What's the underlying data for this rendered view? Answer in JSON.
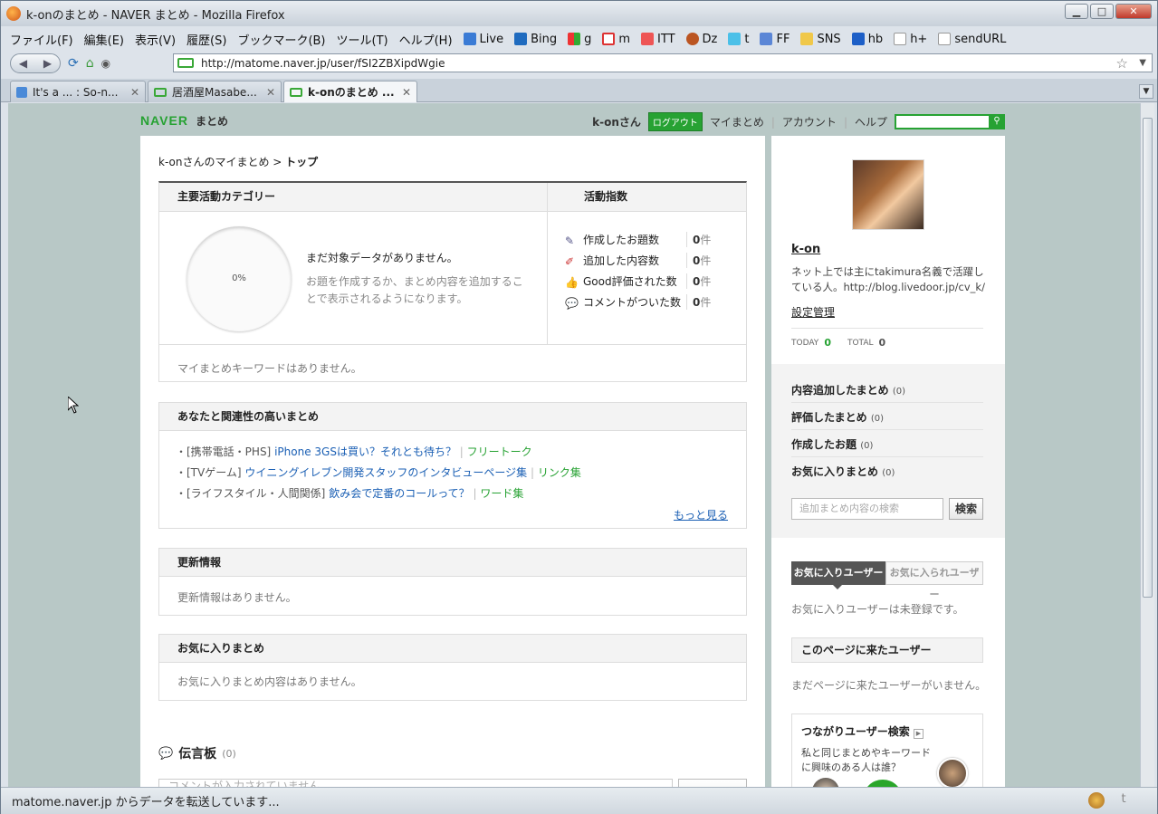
{
  "window": {
    "title": "k-onのまとめ - NAVER まとめ - Mozilla Firefox"
  },
  "menu": {
    "items": [
      "ファイル(F)",
      "編集(E)",
      "表示(V)",
      "履歴(S)",
      "ブックマーク(B)",
      "ツール(T)",
      "ヘルプ(H)"
    ],
    "bookmarks": [
      "Live",
      "Bing",
      "g",
      "m",
      "ITT",
      "Dz",
      "t",
      "FF",
      "SNS",
      "hb",
      "h+",
      "sendURL"
    ]
  },
  "url": "http://matome.naver.jp/user/fSI2ZBXipdWgie",
  "tabs": [
    {
      "label": "It's a ... : So-n..."
    },
    {
      "label": "居酒屋Masabe..."
    },
    {
      "label": "k-onのまとめ ..."
    }
  ],
  "status": "matome.naver.jp からデータを転送しています...",
  "site": {
    "logo": "NAVER",
    "logo_sub": "まとめ",
    "user": "k-onさん",
    "logout": "ログアウト",
    "links": [
      "マイまとめ",
      "アカウント",
      "ヘルプ"
    ]
  },
  "main": {
    "breadcrumb_user": "k-onさんのマイまとめ",
    "breadcrumb_sep": " > ",
    "breadcrumb_current": "トップ",
    "category_head": "主要活動カテゴリー",
    "activity_head": "活動指数",
    "pie_label": "0%",
    "nodata": "まだ対象データがありません。",
    "nodata_desc": "お題を作成するか、まとめ内容を追加することで表示されるようになります。",
    "stats": [
      {
        "label": "作成したお題数",
        "value": "0",
        "unit": "件"
      },
      {
        "label": "追加した内容数",
        "value": "0",
        "unit": "件"
      },
      {
        "label": "Good評価された数",
        "value": "0",
        "unit": "件"
      },
      {
        "label": "コメントがついた数",
        "value": "0",
        "unit": "件"
      }
    ],
    "keywords_empty": "マイまとめキーワードはありません。",
    "related_head": "あなたと関連性の高いまとめ",
    "related": [
      {
        "cat": "・[携帯電話・PHS]",
        "title": "iPhone 3GSは買い？それとも待ち？",
        "tag": "フリートーク"
      },
      {
        "cat": "・[TVゲーム]",
        "title": "ウイニングイレブン開発スタッフのインタビューページ集",
        "tag": "リンク集"
      },
      {
        "cat": "・[ライフスタイル・人間関係]",
        "title": "飲み会で定番のコールって？",
        "tag": "ワード集"
      }
    ],
    "more": "もっと見る",
    "updates_head": "更新情報",
    "updates_empty": "更新情報はありません。",
    "fav_head": "お気に入りまとめ",
    "fav_empty": "お気に入りまとめ内容はありません。",
    "board_title": "伝言板",
    "board_count": "(0)",
    "comment_placeholder": "コメントが入力されていません"
  },
  "side": {
    "name": "k-on",
    "desc": "ネット上では主にtakimura名義で活躍している人。http://blog.livedoor.jp/cv_k/",
    "settings": "設定管理",
    "today_label": "TODAY",
    "today": "0",
    "total_label": "TOTAL",
    "total": "0",
    "items": [
      {
        "label": "内容追加したまとめ",
        "count": "(0)"
      },
      {
        "label": "評価したまとめ",
        "count": "(0)"
      },
      {
        "label": "作成したお題",
        "count": "(0)"
      },
      {
        "label": "お気に入りまとめ",
        "count": "(0)"
      }
    ],
    "search_placeholder": "追加まとめ内容の検索",
    "search_btn": "検索",
    "tab_fav": "お気に入りユーザー",
    "tab_faved": "お気に入られユーザー",
    "fav_users_empty": "お気に入りユーザーは未登録です。",
    "visitors_head": "このページに来たユーザー",
    "visitors_empty": "まだページに来たユーザーがいません。",
    "connect_title": "つながりユーザー検索",
    "connect_desc": "私と同じまとめやキーワードに興味のある人は誰？"
  }
}
